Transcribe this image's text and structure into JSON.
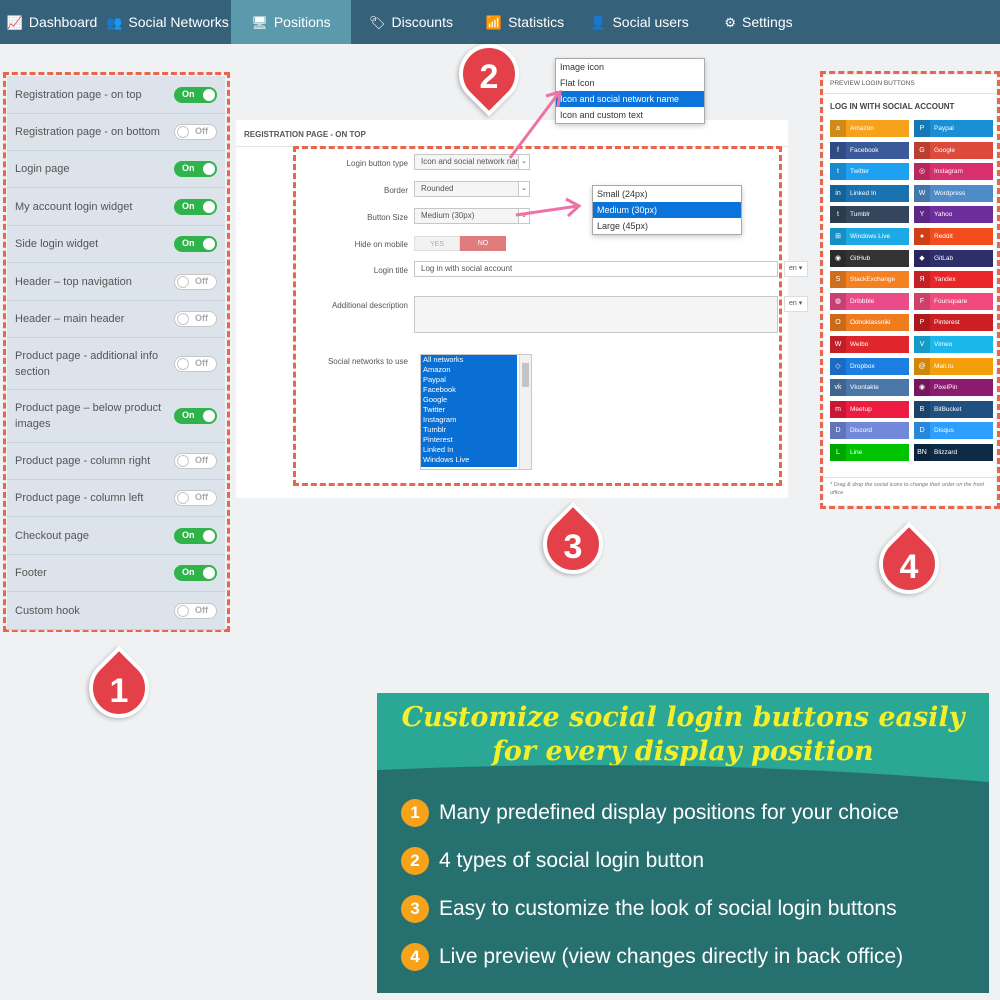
{
  "nav": [
    {
      "label": "Dashboard",
      "icon": "chart-icon",
      "glyph": "📈",
      "active": false
    },
    {
      "label": "Social Networks",
      "icon": "users-icon",
      "glyph": "👥",
      "active": false
    },
    {
      "label": "Positions",
      "icon": "monitor-icon",
      "glyph": "🖥",
      "active": true
    },
    {
      "label": "Discounts",
      "icon": "tag-icon",
      "glyph": "🏷",
      "active": false
    },
    {
      "label": "Statistics",
      "icon": "signal-icon",
      "glyph": "📶",
      "active": false
    },
    {
      "label": "Social users",
      "icon": "user-icon",
      "glyph": "👤",
      "active": false
    },
    {
      "label": "Settings",
      "icon": "gear-icon",
      "glyph": "⚙",
      "active": false
    }
  ],
  "positions": [
    {
      "label": "Registration page - on top",
      "on": true
    },
    {
      "label": "Registration page - on bottom",
      "on": false
    },
    {
      "label": "Login page",
      "on": true
    },
    {
      "label": "My account login widget",
      "on": true
    },
    {
      "label": "Side login widget",
      "on": true
    },
    {
      "label": "Header – top navigation",
      "on": false
    },
    {
      "label": "Header – main header",
      "on": false
    },
    {
      "label": "Product page - additional info section",
      "on": false
    },
    {
      "label": "Product page – below product images",
      "on": true
    },
    {
      "label": "Product page - column right",
      "on": false
    },
    {
      "label": "Product page - column left",
      "on": false
    },
    {
      "label": "Checkout page",
      "on": true
    },
    {
      "label": "Footer",
      "on": true
    },
    {
      "label": "Custom hook",
      "on": false
    }
  ],
  "toggle": {
    "on": "On",
    "off": "Off"
  },
  "badges": [
    "1",
    "2",
    "3",
    "4"
  ],
  "config": {
    "header": "REGISTRATION PAGE - ON TOP",
    "login_button_type_label": "Login button type",
    "login_button_type_value": "Icon and social network nam",
    "border_label": "Border",
    "border_value": "Rounded",
    "button_size_label": "Button Size",
    "button_size_value": "Medium (30px)",
    "hide_mobile_label": "Hide on mobile",
    "yes": "YES",
    "no": "NO",
    "login_title_label": "Login title",
    "login_title_value": "Log in with social account",
    "lang": "en",
    "additional_desc_label": "Additional description",
    "networks_label": "Social networks to use",
    "networks": [
      "All networks",
      "Amazon",
      "Paypal",
      "Facebook",
      "Google",
      "Twitter",
      "Instagram",
      "Tumblr",
      "Pinterest",
      "Linked In",
      "Windows Live"
    ]
  },
  "button_type_options": [
    "Image icon",
    "Flat Icon",
    "Icon and social network name",
    "Icon and custom text"
  ],
  "button_type_selected": 2,
  "size_options": [
    "Small (24px)",
    "Medium (30px)",
    "Large (45px)"
  ],
  "size_selected": 1,
  "preview": {
    "header": "PREVIEW LOGIN BUTTONS",
    "title": "LOG IN WITH SOCIAL ACCOUNT",
    "note": "* Drag & drop the social icons to change their order on the front office",
    "buttons": [
      {
        "name": "Amazon",
        "color": "#f7a21b",
        "glyph": "a"
      },
      {
        "name": "Paypal",
        "color": "#1a8fd6",
        "glyph": "P"
      },
      {
        "name": "Facebook",
        "color": "#3b5a9a",
        "glyph": "f"
      },
      {
        "name": "Google",
        "color": "#db4a3b",
        "glyph": "G"
      },
      {
        "name": "Twitter",
        "color": "#1da1f2",
        "glyph": "t"
      },
      {
        "name": "Instagram",
        "color": "#d9306d",
        "glyph": "◎"
      },
      {
        "name": "Linked In",
        "color": "#1a72b0",
        "glyph": "in"
      },
      {
        "name": "Wordpress",
        "color": "#4f8bc9",
        "glyph": "W"
      },
      {
        "name": "Tumblr",
        "color": "#35465c",
        "glyph": "t"
      },
      {
        "name": "Yahoo",
        "color": "#6b2e9b",
        "glyph": "Y"
      },
      {
        "name": "Windows Live",
        "color": "#1ca9e6",
        "glyph": "⊞"
      },
      {
        "name": "Reddit",
        "color": "#f34d1d",
        "glyph": "●"
      },
      {
        "name": "GitHub",
        "color": "#333333",
        "glyph": "◉"
      },
      {
        "name": "GitLab",
        "color": "#2e2e6b",
        "glyph": "◆"
      },
      {
        "name": "StackExchange",
        "color": "#f48024",
        "glyph": "S"
      },
      {
        "name": "Yandex",
        "color": "#e8262a",
        "glyph": "Я"
      },
      {
        "name": "Dribbble",
        "color": "#ea4c89",
        "glyph": "◍"
      },
      {
        "name": "Foursquare",
        "color": "#f24a7f",
        "glyph": "F"
      },
      {
        "name": "Odnoklassniki",
        "color": "#ef7d20",
        "glyph": "O"
      },
      {
        "name": "Pinterest",
        "color": "#cb1f24",
        "glyph": "P"
      },
      {
        "name": "Weibo",
        "color": "#e0262d",
        "glyph": "W"
      },
      {
        "name": "Vimeo",
        "color": "#1ab7ea",
        "glyph": "V"
      },
      {
        "name": "Dropbox",
        "color": "#1e7fe3",
        "glyph": "◇"
      },
      {
        "name": "Mail.ru",
        "color": "#f59e0b",
        "glyph": "@"
      },
      {
        "name": "Vkontakte",
        "color": "#4a76a8",
        "glyph": "vk"
      },
      {
        "name": "PixelPin",
        "color": "#8b1b6f",
        "glyph": "◉"
      },
      {
        "name": "Meetup",
        "color": "#ed1c40",
        "glyph": "m"
      },
      {
        "name": "BitBucket",
        "color": "#205081",
        "glyph": "B"
      },
      {
        "name": "Discord",
        "color": "#7289da",
        "glyph": "D"
      },
      {
        "name": "Disqus",
        "color": "#2e9fff",
        "glyph": "D"
      },
      {
        "name": "Line",
        "color": "#00c300",
        "glyph": "L"
      },
      {
        "name": "Blizzard",
        "color": "#0e2a47",
        "glyph": "BN"
      }
    ]
  },
  "features": {
    "title_line1": "Customize social login buttons easily",
    "title_line2": "for every display position",
    "items": [
      {
        "num": "1",
        "text": "Many predefined display positions for your choice"
      },
      {
        "num": "2",
        "text": "4 types of social login button"
      },
      {
        "num": "3",
        "text": "Easy to customize the look of social login buttons"
      },
      {
        "num": "4",
        "text": "Live preview (view changes directly in back office)"
      }
    ]
  },
  "colors": {
    "nav_bg": "#35617a",
    "nav_active": "#5b9aad",
    "dash": "#e8664e",
    "badge": "#e3404a",
    "toggle_on": "#2fb34a",
    "feature_top": "#2aa795",
    "feature_bottom": "#26706f",
    "feature_title": "#f5ee2a",
    "feature_number": "#f7a21b"
  }
}
